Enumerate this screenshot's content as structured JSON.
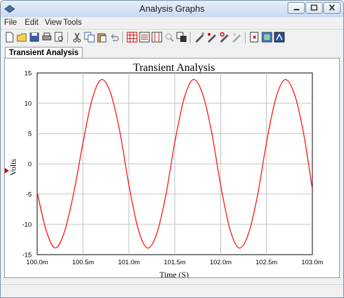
{
  "window": {
    "title": "Analysis Graphs"
  },
  "menu": {
    "items": [
      "File",
      "Edit",
      "View",
      "Tools"
    ]
  },
  "toolbar": {
    "buttons": [
      "new-file-icon",
      "open-folder-icon",
      "save-icon",
      "print-icon",
      "print-preview-icon",
      "cut-icon",
      "copy-icon",
      "paste-icon",
      "undo-icon",
      "toggle-grid-icon",
      "toggle-legend-icon",
      "show-cursors-icon",
      "zoom-icon",
      "overlay-traces-icon",
      "reverse-colors-icon",
      "select-marks-icon",
      "restore-icon",
      "properties-icon",
      "export-excel-icon",
      "export-mathcad-icon",
      "export-lvm-icon"
    ]
  },
  "tabs": [
    {
      "label": "Transient Analysis",
      "active": true
    }
  ],
  "colors": {
    "trace": "#ff0000",
    "grid": "#c0c0c0",
    "marker": "#dd0000"
  },
  "chart_data": {
    "type": "line",
    "title": "Transient Analysis",
    "xlabel": "Time (S)",
    "ylabel": "Volts",
    "x_range": [
      100.0,
      103.0
    ],
    "ylim": [
      -15,
      15
    ],
    "x_ticks": [
      "100.0m",
      "100.5m",
      "101.0m",
      "101.5m",
      "102.0m",
      "102.5m",
      "103.0m"
    ],
    "x_tick_values": [
      100.0,
      100.5,
      101.0,
      101.5,
      102.0,
      102.5,
      103.0
    ],
    "y_ticks": [
      "15",
      "10",
      "5",
      "0",
      "-5",
      "-10",
      "-15"
    ],
    "y_tick_values": [
      15,
      10,
      5,
      0,
      -5,
      -10,
      -15
    ],
    "grid": true,
    "series": [
      {
        "color": "#ff0000",
        "x": [
          100.0,
          100.1,
          100.2,
          100.3,
          100.4,
          100.5,
          100.6,
          100.7,
          100.8,
          100.9,
          101.0,
          101.1,
          101.2,
          101.3,
          101.4,
          101.5,
          101.6,
          101.7,
          101.8,
          101.9,
          102.0,
          102.1,
          102.2,
          102.3,
          102.4,
          102.5,
          102.6,
          102.7,
          102.8,
          102.9,
          103.0
        ],
        "y": [
          -4.7,
          -11.1,
          -13.9,
          -11.1,
          -4.7,
          3.5,
          10.7,
          13.9,
          11.7,
          5.4,
          -3.5,
          -10.7,
          -13.9,
          -11.7,
          -5.4,
          3.5,
          10.7,
          13.9,
          11.7,
          5.4,
          -3.5,
          -10.7,
          -13.9,
          -11.7,
          -5.4,
          3.5,
          10.7,
          13.9,
          11.7,
          5.4,
          -4.2
        ]
      }
    ]
  }
}
